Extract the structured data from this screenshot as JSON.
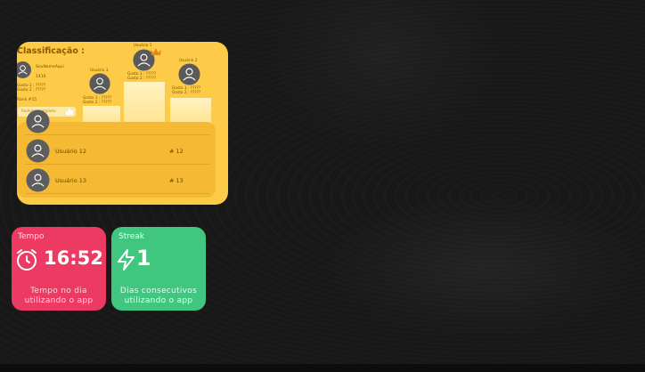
{
  "ranking": {
    "title": "Classificação :",
    "me": {
      "name": "SeuNomeAqui",
      "score": "1416",
      "gosto1": "Gosto 1 : ?????",
      "gosto2": "Gosto 2 : ?????",
      "rank": "Rank #15"
    },
    "button_label": "Ranking completo",
    "button_icon": "podium-icon",
    "podium": [
      {
        "name": "Usuário 3",
        "g1": "Gosto 1 : ?????",
        "g2": "Gosto 2 : ?????"
      },
      {
        "name": "Usuário 1",
        "g1": "Gosto 1 : ?????",
        "g2": "Gosto 2 : ?????"
      },
      {
        "name": "Usuário 2",
        "g1": "Gosto 1 : ?????",
        "g2": "Gosto 2 : ?????"
      }
    ],
    "list": [
      {
        "name": "Usuário 12",
        "rank": "# 12"
      },
      {
        "name": "Usuário 13",
        "rank": "# 13"
      }
    ],
    "colors": {
      "card": "#fecb48",
      "panel": "#f5b933",
      "text": "#7a5200"
    }
  },
  "stats": {
    "time": {
      "title": "Tempo",
      "value": "16:52",
      "desc_line1": "Tempo no dia",
      "desc_line2": "utilizando o app",
      "icon": "clock-icon",
      "color": "#ec3a63"
    },
    "streak": {
      "title": "Streak",
      "value": "1",
      "desc_line1": "Dias consecutivos",
      "desc_line2": "utilizando o app",
      "icon": "lightning-icon",
      "color": "#41c680"
    }
  }
}
